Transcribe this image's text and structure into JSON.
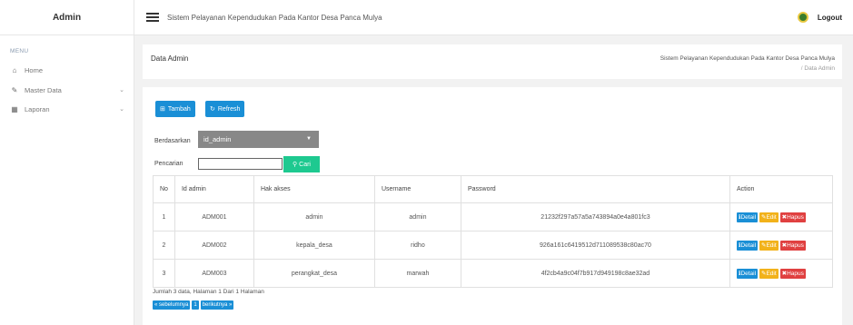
{
  "brand": "Admin",
  "topbar": {
    "app_title": "Sistem Pelayanan Kependudukan Pada Kantor Desa Panca Mulya",
    "logout_label": "Logout"
  },
  "sidebar": {
    "menu_heading": "MENU",
    "items": [
      {
        "label": "Home"
      },
      {
        "label": "Master Data"
      },
      {
        "label": "Laporan"
      }
    ]
  },
  "page": {
    "title": "Data Admin",
    "breadcrumb_root": "Sistem Pelayanan Kependudukan Pada Kantor Desa Panca Mulya",
    "breadcrumb_sep": "/",
    "breadcrumb_current": "Data Admin"
  },
  "toolbar": {
    "tambah_label": "Tambah",
    "refresh_label": "Refresh"
  },
  "filter": {
    "by_label": "Berdasarkan",
    "selected_field": "id_admin",
    "search_label": "Pencarian",
    "search_value": "",
    "cari_label": "Cari"
  },
  "table": {
    "headers": [
      "No",
      "Id admin",
      "Hak akses",
      "Username",
      "Password",
      "Action"
    ],
    "rows": [
      {
        "no": "1",
        "id": "ADM001",
        "hak": "admin",
        "user": "admin",
        "pass": "21232f297a57a5a743894a0e4a801fc3"
      },
      {
        "no": "2",
        "id": "ADM002",
        "hak": "kepala_desa",
        "user": "ridho",
        "pass": "926a161c6419512d711089538c80ac70"
      },
      {
        "no": "3",
        "id": "ADM003",
        "hak": "perangkat_desa",
        "user": "marwah",
        "pass": "4f2cb4a9c04f7b917d949198c8ae32ad"
      }
    ],
    "actions": {
      "detail": "Detail",
      "edit": "Edit",
      "hapus": "Hapus"
    }
  },
  "summary": "Jumlah 3 data, Halaman 1 Dari 1 Halaman",
  "pagination": {
    "prev": "« sebelumnya",
    "page": "1",
    "next": "berikutnya »"
  },
  "colors": {
    "primary": "#1a8fd6",
    "success": "#1ec990",
    "warning": "#f2b21a",
    "danger": "#e04040",
    "select_bg": "#888888"
  }
}
